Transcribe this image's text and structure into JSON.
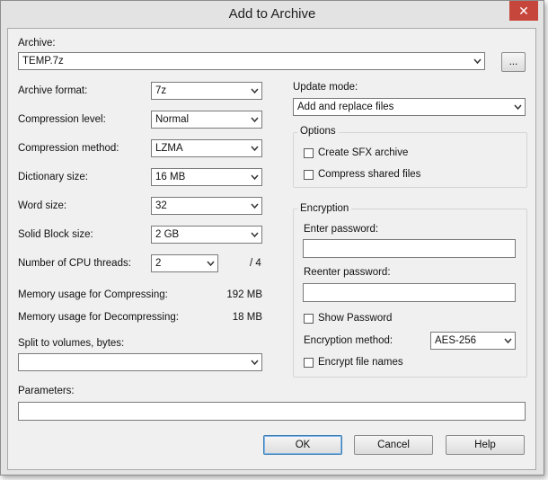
{
  "window": {
    "title": "Add to Archive",
    "close_glyph": "✕"
  },
  "archive": {
    "label": "Archive:",
    "value": "TEMP.7z",
    "browse_label": "..."
  },
  "left": {
    "format": {
      "label": "Archive format:",
      "value": "7z"
    },
    "level": {
      "label": "Compression level:",
      "value": "Normal"
    },
    "method": {
      "label": "Compression method:",
      "value": "LZMA"
    },
    "dictionary": {
      "label": "Dictionary size:",
      "value": "16 MB"
    },
    "word": {
      "label": "Word size:",
      "value": "32"
    },
    "solid": {
      "label": "Solid Block size:",
      "value": "2 GB"
    },
    "threads": {
      "label": "Number of CPU threads:",
      "value": "2",
      "max": "/ 4"
    },
    "mem_compress": {
      "label": "Memory usage for Compressing:",
      "value": "192 MB"
    },
    "mem_decompress": {
      "label": "Memory usage for Decompressing:",
      "value": "18 MB"
    },
    "split": {
      "label": "Split to volumes, bytes:",
      "value": ""
    }
  },
  "right": {
    "update": {
      "label": "Update mode:",
      "value": "Add and replace files"
    },
    "options": {
      "title": "Options",
      "sfx": {
        "label": "Create SFX archive",
        "checked": false
      },
      "shared": {
        "label": "Compress shared files",
        "checked": false
      }
    },
    "encryption": {
      "title": "Encryption",
      "password_label": "Enter password:",
      "password_value": "",
      "reenter_label": "Reenter password:",
      "reenter_value": "",
      "show_password": {
        "label": "Show Password",
        "checked": false
      },
      "method_label": "Encryption method:",
      "method_value": "AES-256",
      "encrypt_names": {
        "label": "Encrypt file names",
        "checked": false
      }
    }
  },
  "parameters": {
    "label": "Parameters:",
    "value": ""
  },
  "buttons": {
    "ok": "OK",
    "cancel": "Cancel",
    "help": "Help"
  },
  "colors": {
    "close_button": "#c7463c",
    "default_button_border": "#3c7fb1",
    "dialog_bg": "#f0f0f0"
  },
  "icons": {
    "dropdown": "chevron-down-icon",
    "close": "close-icon"
  }
}
